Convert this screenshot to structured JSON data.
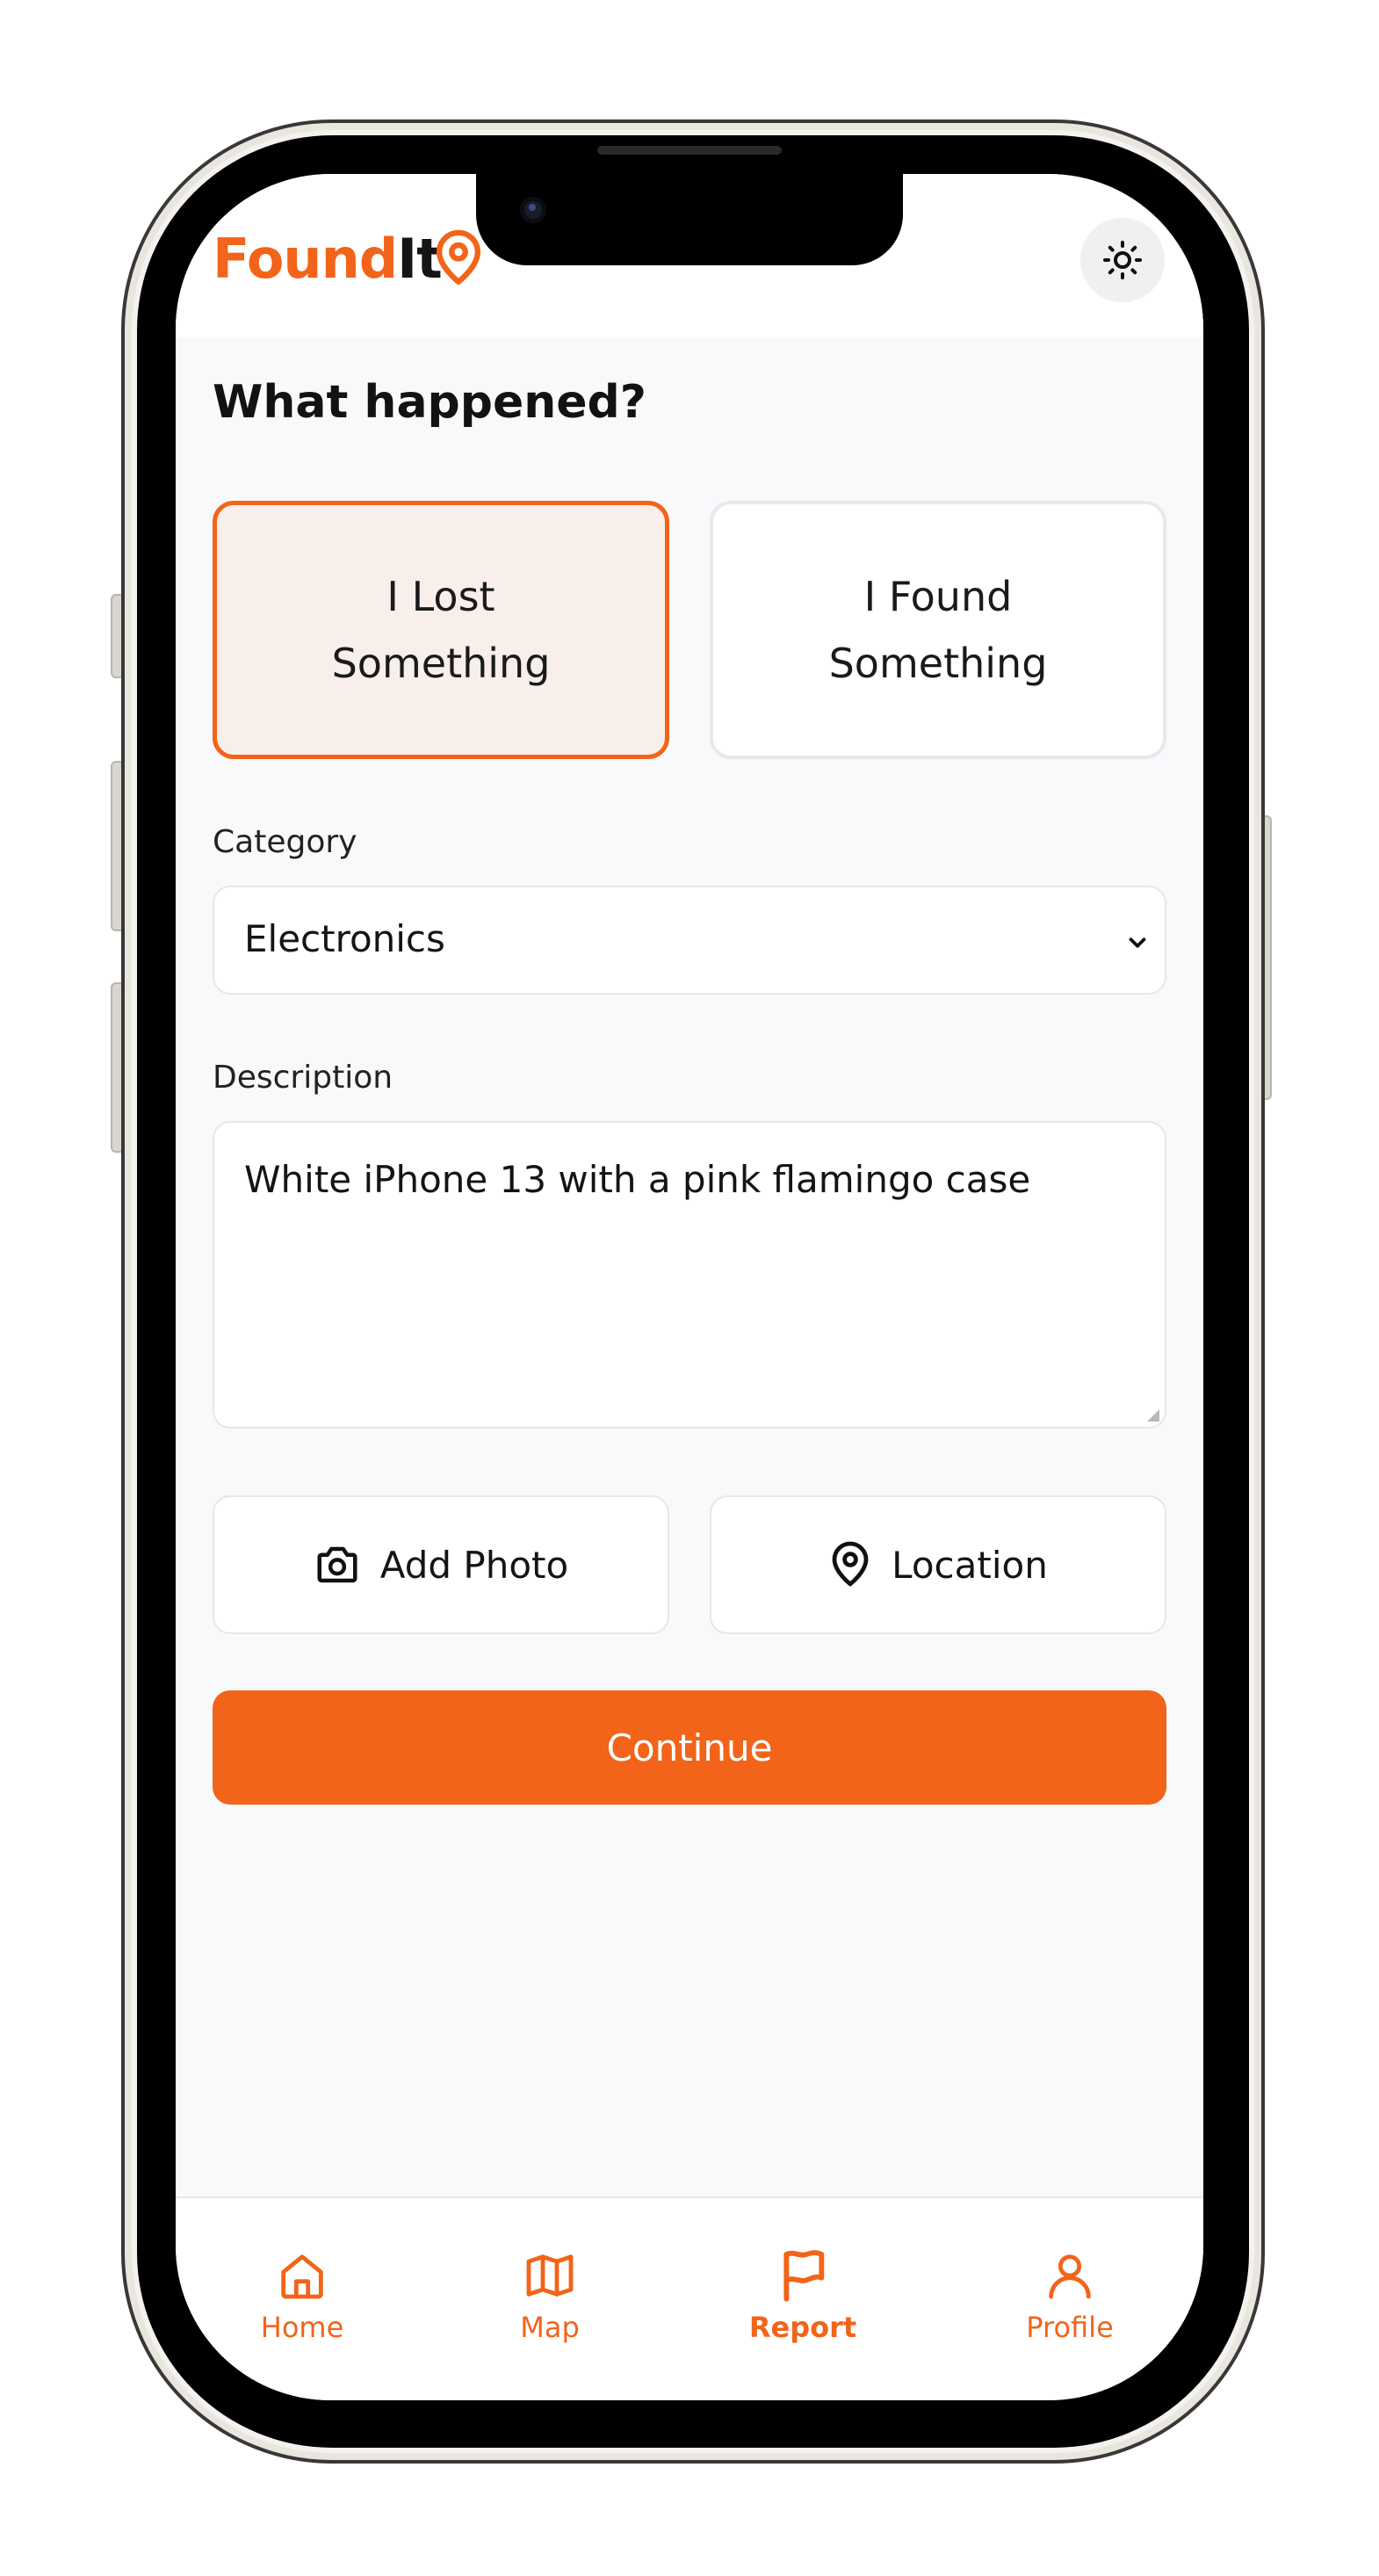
{
  "app": {
    "logo_part1": "Found",
    "logo_part2": "It",
    "accent_color": "#f26419"
  },
  "header": {
    "theme_icon": "sun-icon",
    "logo_icon": "map-pin-icon"
  },
  "form": {
    "title": "What happened?",
    "choices": [
      {
        "label": "I Lost Something",
        "selected": true
      },
      {
        "label": "I Found Something",
        "selected": false
      }
    ],
    "category_label": "Category",
    "category_value": "Electronics",
    "description_label": "Description",
    "description_value": "White iPhone 13 with a pink flamingo case",
    "add_photo_label": "Add Photo",
    "location_label": "Location",
    "continue_label": "Continue"
  },
  "nav": {
    "items": [
      {
        "label": "Home",
        "icon": "home-icon",
        "active": false
      },
      {
        "label": "Map",
        "icon": "map-icon",
        "active": false
      },
      {
        "label": "Report",
        "icon": "flag-icon",
        "active": true
      },
      {
        "label": "Profile",
        "icon": "user-icon",
        "active": false
      }
    ]
  }
}
